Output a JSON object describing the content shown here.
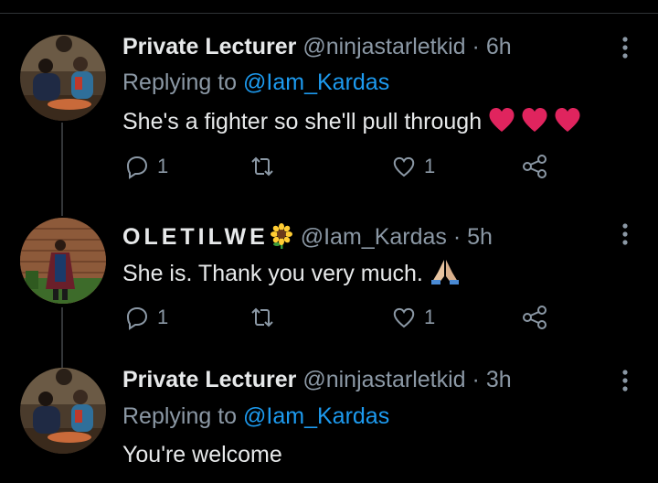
{
  "tweets": [
    {
      "name": "Private Lecturer",
      "handle": "@ninjastarletkid",
      "separator": "·",
      "time": "6h",
      "replying_prefix": "Replying to",
      "replying_to": "@Iam_Kardas",
      "text": "She's a fighter so she'll pull through",
      "text_emoji": [
        "red-heart",
        "red-heart",
        "red-heart"
      ],
      "reply_count": "1",
      "retweet_count": "",
      "like_count": "1"
    },
    {
      "name": "OLETILWE",
      "name_emoji": "sunflower",
      "handle": "@Iam_Kardas",
      "separator": "·",
      "time": "5h",
      "text": "She is. Thank you very much.",
      "text_emoji": [
        "folded-hands"
      ],
      "reply_count": "1",
      "retweet_count": "",
      "like_count": "1"
    },
    {
      "name": "Private Lecturer",
      "handle": "@ninjastarletkid",
      "separator": "·",
      "time": "3h",
      "replying_prefix": "Replying to",
      "replying_to": "@Iam_Kardas",
      "text": "You're welcome"
    }
  ],
  "colors": {
    "background": "#000000",
    "primary_text": "#e7e9ea",
    "secondary_text": "#8b98a5",
    "link": "#1d9bf0",
    "thread_line": "#333639",
    "heart": "#e0245e"
  },
  "icons": {
    "reply": "reply-icon",
    "retweet": "retweet-icon",
    "like": "like-icon",
    "share": "share-icon",
    "more": "more-options-icon"
  }
}
